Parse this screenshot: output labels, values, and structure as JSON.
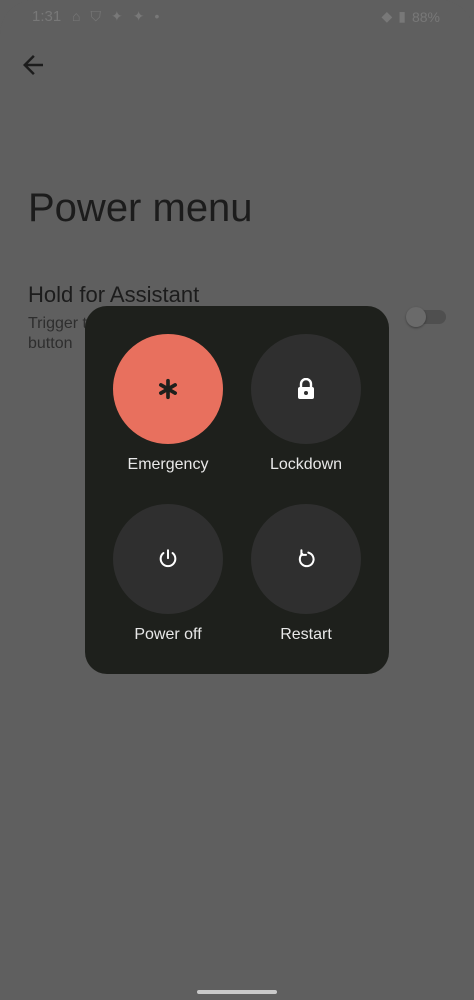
{
  "status_bar": {
    "time": "1:31",
    "battery": "88%"
  },
  "page": {
    "title": "Power menu"
  },
  "setting": {
    "title": "Hold for Assistant",
    "description": "Trigger t… button",
    "desc_line1": "Trigger t",
    "desc_line2": "button",
    "toggle_on": false
  },
  "power_menu": {
    "actions": [
      {
        "label": "Emergency",
        "icon": "emergency-asterisk-icon",
        "color": "#e8705e"
      },
      {
        "label": "Lockdown",
        "icon": "lock-icon"
      },
      {
        "label": "Power off",
        "icon": "power-icon"
      },
      {
        "label": "Restart",
        "icon": "restart-icon"
      }
    ]
  }
}
